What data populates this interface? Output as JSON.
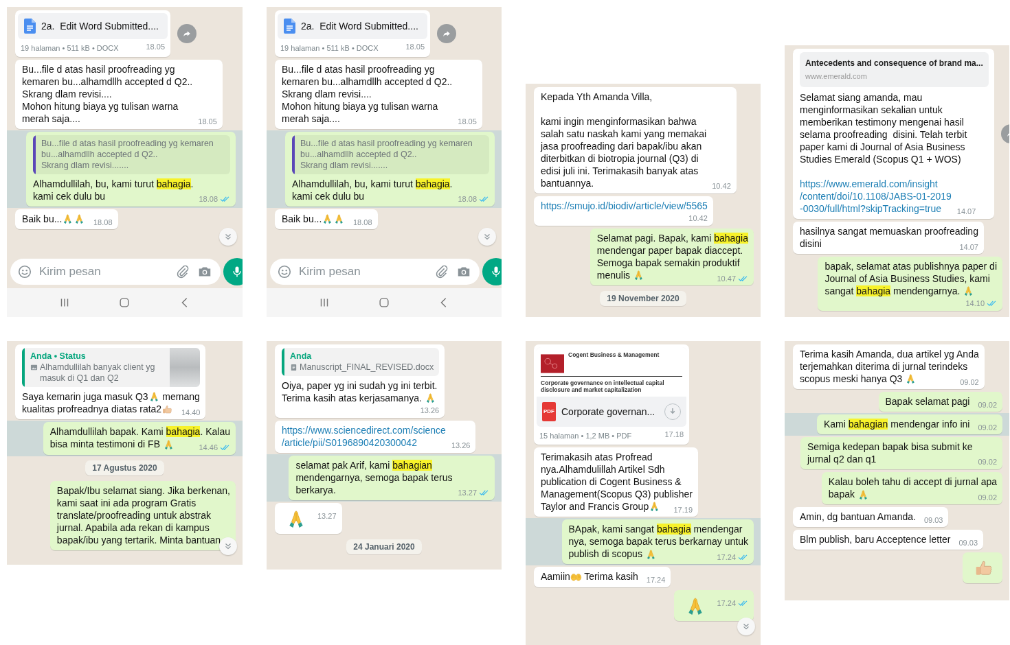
{
  "panels": [
    {
      "messages": [
        {
          "kind": "docx",
          "outgoing": false,
          "title": "2a.  Edit Word Submitted....",
          "meta": "19 halaman • 511 kB • DOCX",
          "time": "18.05",
          "forward_button": true
        },
        {
          "kind": "text",
          "outgoing": false,
          "parts": [
            {
              "kind": "paragraph",
              "text": "Bu...file d atas hasil proofreading yg\nkemaren bu...alhamdllh accepted d Q2..\nSkrang dlam revisi....\nMohon hitung biaya yg tulisan warna\nmerah saja...."
            }
          ],
          "time": "18.05"
        },
        {
          "kind": "text",
          "outgoing": true,
          "highlighted": true,
          "quote": {
            "kind": "text",
            "color": "#5b47b8",
            "text": "Bu...file d atas hasil proofreading yg kemaren\nbu...alhamdllh accepted d Q2..\nSkrang dlam revisi......."
          },
          "parts": [
            {
              "kind": "paragraph",
              "text": "Alhamdullilah, bu, kami turut **bahagia**.\nkami cek dulu bu"
            }
          ],
          "time": "18.08",
          "read": true
        },
        {
          "kind": "text",
          "outgoing": false,
          "parts": [
            {
              "kind": "text",
              "text": "Baik bu..."
            },
            {
              "kind": "pray"
            },
            {
              "kind": "pray"
            }
          ],
          "time": "18.08"
        }
      ],
      "scroll_button": true,
      "composer": {
        "placeholder": "Kirim pesan"
      },
      "nav_bar": true
    },
    {
      "messages": [
        {
          "kind": "docx",
          "outgoing": false,
          "title": "2a.  Edit Word Submitted....",
          "meta": "19 halaman • 511 kB • DOCX",
          "time": "18.05",
          "forward_button": true
        },
        {
          "kind": "text",
          "outgoing": false,
          "parts": [
            {
              "kind": "paragraph",
              "text": "Bu...file d atas hasil proofreading yg\nkemaren bu...alhamdllh accepted d Q2..\nSkrang dlam revisi....\nMohon hitung biaya yg tulisan warna\nmerah saja...."
            }
          ],
          "time": "18.05"
        },
        {
          "kind": "text",
          "outgoing": true,
          "highlighted": true,
          "quote": {
            "kind": "text",
            "color": "#5b47b8",
            "text": "Bu...file d atas hasil proofreading yg kemaren\nbu...alhamdllh accepted d Q2..\nSkrang dlam revisi......."
          },
          "parts": [
            {
              "kind": "paragraph",
              "text": "Alhamdullilah, bu, kami turut **bahagia**.\nkami cek dulu bu"
            }
          ],
          "time": "18.08",
          "read": true
        },
        {
          "kind": "text",
          "outgoing": false,
          "parts": [
            {
              "kind": "text",
              "text": "Baik bu..."
            },
            {
              "kind": "pray"
            },
            {
              "kind": "pray"
            }
          ],
          "time": "18.08"
        }
      ],
      "scroll_button": true,
      "composer": {
        "placeholder": "Kirim pesan"
      },
      "nav_bar": true
    },
    {
      "messages": [
        {
          "kind": "text",
          "outgoing": false,
          "parts": [
            {
              "kind": "paragraph",
              "text": "Kepada Yth Amanda Villa,\n\nkami ingin menginformasikan bahwa\nsalah satu naskah kami yang memakai\njasa proofreading dari bapak/ibu akan\nditerbitkan di biotropia journal (Q3) di\nedisi juli ini. Terimakasih banyak atas\nbantuannya."
            }
          ],
          "time": "10.42"
        },
        {
          "kind": "text",
          "outgoing": false,
          "parts": [
            {
              "kind": "link",
              "text": "https://smujo.id/biodiv/article/view/5565"
            },
            {
              "kind": "break"
            }
          ],
          "time": "10.42"
        },
        {
          "kind": "text",
          "outgoing": true,
          "highlighted": false,
          "parts": [
            {
              "kind": "paragraph",
              "text": "Selamat pagi. Bapak, kami **bahagia**\nmendengar paper bapak diaccept.\nSemoga bapak semakin produktif"
            },
            {
              "kind": "text",
              "text": "menulis "
            },
            {
              "kind": "pray"
            }
          ],
          "time": "10.47",
          "read": true
        },
        {
          "kind": "date",
          "text": "19 November 2020"
        }
      ]
    },
    {
      "messages": [
        {
          "kind": "text",
          "outgoing": false,
          "forward_button": true,
          "preview": {
            "title": "Antecedents and consequence of brand ma...",
            "site": "www.emerald.com"
          },
          "parts": [
            {
              "kind": "paragraph",
              "text": "Selamat siang amanda, mau\nmenginformasikan sekalian untuk\nmemberikan testimony mengenai hasil\nselama proofreading  disini. Telah terbit\npaper kami di Journal of Asia Business\nStudies Emerald (Scopus Q1 + WOS)"
            },
            {
              "kind": "break"
            },
            {
              "kind": "link",
              "text": "https://www.emerald.com/insight\n/content/doi/10.1108/JABS-01-2019\n-0030/full/html?skipTracking=true"
            }
          ],
          "time": "14.07"
        },
        {
          "kind": "text",
          "outgoing": false,
          "parts": [
            {
              "kind": "paragraph",
              "text": "hasilnya sangat memuaskan proofreading"
            },
            {
              "kind": "text",
              "text": "disini"
            }
          ],
          "time": "14.07"
        },
        {
          "kind": "text",
          "outgoing": true,
          "highlighted": false,
          "parts": [
            {
              "kind": "paragraph",
              "text": "bapak, selamat atas publishnya paper di\nJournal of Asia Business Studies, kami"
            },
            {
              "kind": "text",
              "text": "sangat **bahagia** mendengarnya. "
            },
            {
              "kind": "pray"
            },
            {
              "kind": "break"
            }
          ],
          "time": "14.10",
          "read": true
        }
      ]
    },
    {
      "messages": [
        {
          "kind": "text",
          "outgoing": false,
          "quote": {
            "kind": "photo",
            "color": "#06a67e",
            "author": "Anda • Status",
            "text": "Alhamdullilah banyak client yg\nmasuk di Q1 dan Q2"
          },
          "parts": [
            {
              "kind": "text",
              "text": "Saya kemarin juga masuk Q3"
            },
            {
              "kind": "pray"
            },
            {
              "kind": "text",
              "text": " memang"
            },
            {
              "kind": "break"
            },
            {
              "kind": "text",
              "text": "kualitas profreadnya diatas rata2"
            },
            {
              "kind": "thumb"
            }
          ],
          "time": "14.40"
        },
        {
          "kind": "text",
          "outgoing": true,
          "highlighted": true,
          "parts": [
            {
              "kind": "paragraph",
              "text": "Alhamdullilah bapak. Kami **bahagia**. Kalau"
            },
            {
              "kind": "text",
              "text": "bisa minta testimoni di FB "
            },
            {
              "kind": "pray"
            }
          ],
          "time": "14.46",
          "read": true
        },
        {
          "kind": "date",
          "text": "17 Agustus 2020"
        },
        {
          "kind": "text",
          "outgoing": true,
          "highlighted": false,
          "parts": [
            {
              "kind": "paragraph",
              "text": "Bapak/Ibu selamat siang. Jika berkenan,\nkami saat ini ada program Gratis\ntranslate/proofreading untuk abstrak\njurnal. Apabila ada rekan di kampus\nbapak/ibu yang tertarik. Minta bantuan"
            }
          ]
        }
      ],
      "scroll_button": true
    },
    {
      "messages": [
        {
          "kind": "text",
          "outgoing": false,
          "quote": {
            "kind": "document",
            "color": "#06a67e",
            "author": "Anda",
            "text": "Manuscript_FINAL_REVISED.docx"
          },
          "parts": [
            {
              "kind": "paragraph",
              "text": "Oiya, paper yg ini sudah yg ini terbit."
            },
            {
              "kind": "text",
              "text": "Terima kasih atas kerjasamanya. "
            },
            {
              "kind": "pray"
            },
            {
              "kind": "break"
            }
          ],
          "time": "13.26"
        },
        {
          "kind": "text",
          "outgoing": false,
          "parts": [
            {
              "kind": "link",
              "text": "https://www.sciencedirect.com/science\n/article/pii/S0196890420300042"
            }
          ],
          "time": "13.26"
        },
        {
          "kind": "text",
          "outgoing": true,
          "highlighted": true,
          "parts": [
            {
              "kind": "paragraph",
              "text": "selamat pak Arif, kami **bahagian**\nmendengarnya, semoga bapak terus\nberkarya."
            }
          ],
          "time": "13.27",
          "read": true
        },
        {
          "kind": "emoji",
          "outgoing": false,
          "parts": [
            {
              "kind": "pray"
            }
          ],
          "time": "13.27"
        },
        {
          "kind": "date",
          "text": "24 Januari 2020"
        }
      ]
    },
    {
      "messages": [
        {
          "kind": "pdf",
          "outgoing": false,
          "icon_label": "PDF",
          "thumbnail": {
            "heading": "Cogent Business & Management",
            "caption": "Corporate governance on intellectual capital\ndisclosure and market capitalization"
          },
          "title": "Corporate governan...",
          "download_button": true,
          "meta": "15 halaman • 1,2 MB • PDF",
          "time": "17.18"
        },
        {
          "kind": "text",
          "outgoing": false,
          "parts": [
            {
              "kind": "paragraph",
              "text": "Terimakasih atas Profread\nnya.Alhamdulillah Artikel Sdh\npublication di Cogent Business &\nManagement(Scopus Q3) publisher"
            },
            {
              "kind": "text",
              "text": "Taylor and Francis Group"
            },
            {
              "kind": "pray"
            }
          ],
          "time": "17.19"
        },
        {
          "kind": "text",
          "outgoing": true,
          "highlighted": true,
          "parts": [
            {
              "kind": "paragraph",
              "text": "BApak, kami sangat **bahagia** mendengar\nnya, semoga bapak terus berkarnay untuk"
            },
            {
              "kind": "text",
              "text": "publish di scopus "
            },
            {
              "kind": "pray"
            }
          ],
          "time": "17.24",
          "read": true
        },
        {
          "kind": "text",
          "outgoing": false,
          "parts": [
            {
              "kind": "text",
              "text": "Aamiin"
            },
            {
              "kind": "palms"
            },
            {
              "kind": "text",
              "text": " Terima kasih"
            }
          ],
          "time": "17.24"
        },
        {
          "kind": "emoji",
          "outgoing": true,
          "parts": [
            {
              "kind": "pray"
            }
          ],
          "time": "17.24",
          "read": true
        }
      ],
      "scroll_button": true
    },
    {
      "messages": [
        {
          "kind": "text",
          "outgoing": false,
          "parts": [
            {
              "kind": "paragraph",
              "text": "Terima kasih Amanda, dua artikel yg Anda\nterjemahkan diterima di jurnal terindeks"
            },
            {
              "kind": "text",
              "text": "scopus meski hanya Q3 "
            },
            {
              "kind": "pray"
            }
          ],
          "time": "09.02"
        },
        {
          "kind": "text",
          "outgoing": true,
          "highlighted": false,
          "parts": [
            {
              "kind": "text",
              "text": "Bapak selamat pagi"
            }
          ],
          "time": "09.02"
        },
        {
          "kind": "text",
          "outgoing": true,
          "highlighted": true,
          "parts": [
            {
              "kind": "text",
              "text": "Kami **bahagian** mendengar info ini"
            }
          ],
          "time": "09.02"
        },
        {
          "kind": "text",
          "outgoing": true,
          "highlighted": false,
          "parts": [
            {
              "kind": "paragraph",
              "text": "Semiga kedepan bapak bisa submit ke\njurnal q2 dan q1"
            }
          ],
          "time": "09.02"
        },
        {
          "kind": "text",
          "outgoing": true,
          "highlighted": false,
          "parts": [
            {
              "kind": "paragraph",
              "text": "Kalau boleh tahu di accept di jurnal apa"
            },
            {
              "kind": "text",
              "text": "bapak "
            },
            {
              "kind": "pray"
            }
          ],
          "time": "09.02"
        },
        {
          "kind": "text",
          "outgoing": false,
          "parts": [
            {
              "kind": "text",
              "text": "Amin, dg bantuan Amanda."
            }
          ],
          "time": "09.03"
        },
        {
          "kind": "text",
          "outgoing": false,
          "parts": [
            {
              "kind": "text",
              "text": "Blm publish, baru Acceptence letter"
            }
          ],
          "time": "09.03"
        },
        {
          "kind": "emoji",
          "outgoing": true,
          "highlighted": false,
          "parts": [
            {
              "kind": "thumb"
            }
          ]
        }
      ]
    }
  ]
}
